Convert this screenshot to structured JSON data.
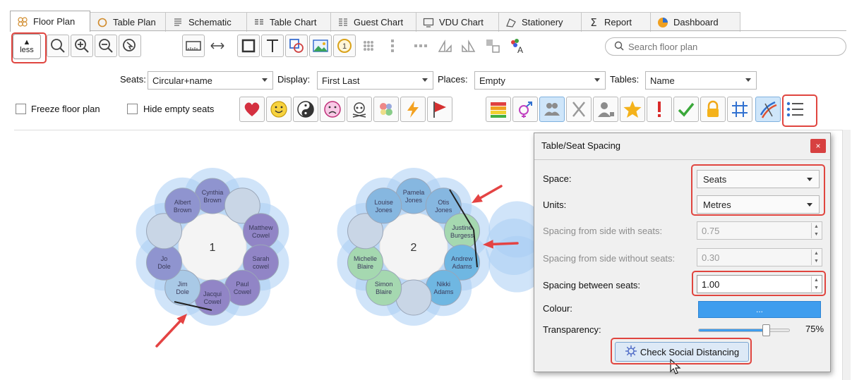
{
  "tabs": [
    {
      "label": "Floor Plan",
      "icon": "floor-plan-icon",
      "active": true
    },
    {
      "label": "Table Plan",
      "icon": "table-plan-icon",
      "active": false
    },
    {
      "label": "Schematic",
      "icon": "schematic-icon",
      "active": false
    },
    {
      "label": "Table Chart",
      "icon": "table-chart-icon",
      "active": false
    },
    {
      "label": "Guest Chart",
      "icon": "guest-chart-icon",
      "active": false
    },
    {
      "label": "VDU Chart",
      "icon": "vdu-chart-icon",
      "active": false
    },
    {
      "label": "Stationery",
      "icon": "stationery-icon",
      "active": false
    },
    {
      "label": "Report",
      "icon": "report-icon",
      "active": false
    },
    {
      "label": "Dashboard",
      "icon": "dashboard-icon",
      "active": false
    }
  ],
  "toolbar": {
    "less_label": "less",
    "search_placeholder": "Search floor plan",
    "seats_label": "Seats:",
    "seats_value": "Circular+name",
    "display_label": "Display:",
    "display_value": "First Last",
    "places_label": "Places:",
    "places_value": "Empty",
    "tables_label": "Tables:",
    "tables_value": "Name",
    "freeze_label": "Freeze floor plan",
    "hide_empty_label": "Hide empty seats"
  },
  "colors": {
    "accent": "#3f9dee",
    "highlight": "#e0453f",
    "seat_fill": "#8a8ac8",
    "seat_halo": "#a9cdf4"
  },
  "tables": [
    {
      "number": "1",
      "seats": [
        {
          "first": "Cynthia",
          "last": "Brown",
          "color": "#8f94cf"
        },
        {
          "first": "",
          "last": "",
          "color": "#c9d6e6"
        },
        {
          "first": "Matthew",
          "last": "Cowel",
          "color": "#9185c6"
        },
        {
          "first": "Sarah",
          "last": "cowel",
          "color": "#9185c6"
        },
        {
          "first": "Paul",
          "last": "Cowel",
          "color": "#9185c6"
        },
        {
          "first": "Jacqui",
          "last": "Cowel",
          "color": "#9185c6"
        },
        {
          "first": "Jim",
          "last": "Dole",
          "color": "#a9c9e6"
        },
        {
          "first": "Jo",
          "last": "Dole",
          "color": "#8f94cf"
        },
        {
          "first": "",
          "last": "",
          "color": "#c9d6e6"
        },
        {
          "first": "Albert",
          "last": "Brown",
          "color": "#8f94cf"
        }
      ]
    },
    {
      "number": "2",
      "seats": [
        {
          "first": "Pamela",
          "last": "Jones",
          "color": "#86b7e0"
        },
        {
          "first": "Otis",
          "last": "Jones",
          "color": "#86b7e0"
        },
        {
          "first": "Justine",
          "last": "Burgess",
          "color": "#a5d8b0"
        },
        {
          "first": "Andrew",
          "last": "Adams",
          "color": "#6fb7e2"
        },
        {
          "first": "Nikki",
          "last": "Adams",
          "color": "#6fb7e2"
        },
        {
          "first": "",
          "last": "",
          "color": "#c9d6e6"
        },
        {
          "first": "Simon",
          "last": "Blaire",
          "color": "#a5d8b0"
        },
        {
          "first": "Michelle",
          "last": "Blaire",
          "color": "#a5d8b0"
        },
        {
          "first": "",
          "last": "",
          "color": "#c9d6e6"
        },
        {
          "first": "Louise",
          "last": "Jones",
          "color": "#86b7e0"
        }
      ]
    }
  ],
  "dialog": {
    "title": "Table/Seat Spacing",
    "close_glyph": "×",
    "space_label": "Space:",
    "space_value": "Seats",
    "units_label": "Units:",
    "units_value": "Metres",
    "side_seats_label": "Spacing from side with seats:",
    "side_seats_value": "0.75",
    "side_noseats_label": "Spacing from side without seats:",
    "side_noseats_value": "0.30",
    "between_label": "Spacing between seats:",
    "between_value": "1.00",
    "colour_label": "Colour:",
    "colour_button": "...",
    "transparency_label": "Transparency:",
    "transparency_value": "75%",
    "transparency_level": 0.75,
    "check_button": "Check Social Distancing"
  }
}
